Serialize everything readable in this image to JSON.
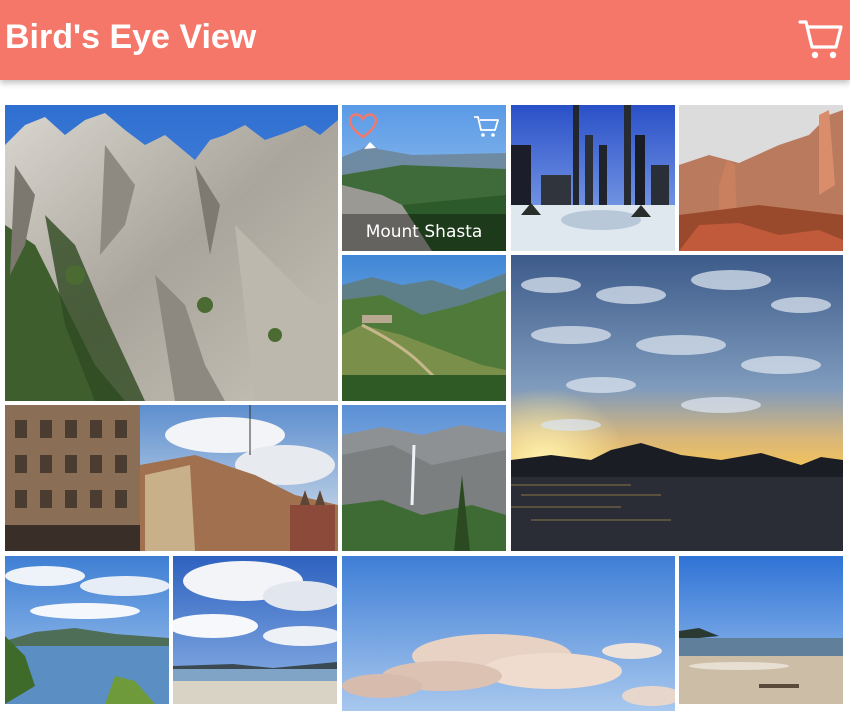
{
  "app": {
    "title": "Bird's Eye View",
    "cart_icon": "shopping-cart-icon"
  },
  "colors": {
    "appbar": "#F5776A",
    "on_appbar": "#FFFFFF",
    "favorite": "#F5776A"
  },
  "photos": [
    {
      "id": "castle-crags",
      "caption": ""
    },
    {
      "id": "mount-shasta",
      "caption": "Mount Shasta",
      "icons": [
        "heart-outline-icon",
        "add-to-cart-icon"
      ]
    },
    {
      "id": "city-skyline",
      "caption": ""
    },
    {
      "id": "red-rock-spires",
      "caption": ""
    },
    {
      "id": "mountain-valley-town",
      "caption": ""
    },
    {
      "id": "sunset-lake",
      "caption": ""
    },
    {
      "id": "old-street-buildings",
      "caption": ""
    },
    {
      "id": "yosemite-falls",
      "caption": ""
    },
    {
      "id": "island-bay",
      "caption": ""
    },
    {
      "id": "cloudy-coast",
      "caption": ""
    },
    {
      "id": "pink-clouds-sky",
      "caption": ""
    },
    {
      "id": "sandy-beach",
      "caption": ""
    }
  ]
}
